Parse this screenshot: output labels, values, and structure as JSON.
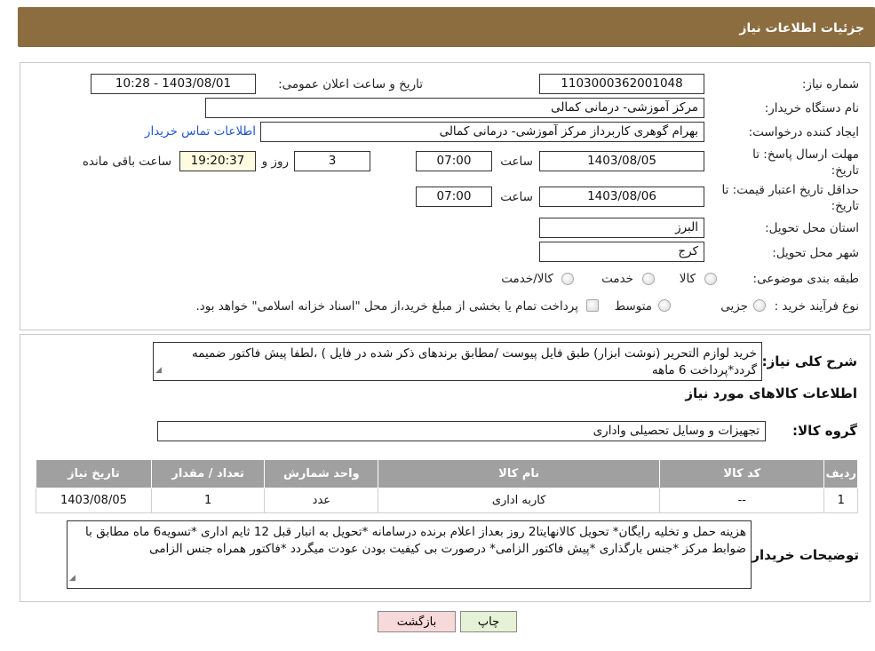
{
  "header": {
    "title": "جزئیات اطلاعات نیاز"
  },
  "form": {
    "need_number_label": "شماره نیاز:",
    "need_number": "1103000362001048",
    "announce_label": "تاریخ و ساعت اعلان عمومی:",
    "announce_value": "1403/08/01 - 10:28",
    "buyer_org_label": "نام دستگاه خریدار:",
    "buyer_org": "مرکز آموزشی- درمانی کمالی",
    "creator_label": "ایجاد کننده درخواست:",
    "creator": "بهرام گوهری کاربرداز مرکز آموزشی- درمانی کمالی",
    "contact_link": "اطلاعات تماس خریدار",
    "deadline_label_1": "مهلت ارسال پاسخ: تا",
    "deadline_label_2": "تاریخ:",
    "deadline_date": "1403/08/05",
    "time_label": "ساعت",
    "deadline_time": "07:00",
    "days_value": "3",
    "days_label": "روز و",
    "remaining_time": "19:20:37",
    "remaining_label": "ساعت باقی مانده",
    "validity_label_1": "حداقل تاریخ اعتبار قیمت: تا",
    "validity_label_2": "تاریخ:",
    "validity_date": "1403/08/06",
    "validity_time": "07:00",
    "province_label": "استان محل تحویل:",
    "province": "البرز",
    "city_label": "شهر محل تحویل:",
    "city": "کرج",
    "category_label": "طبقه بندی موضوعی:",
    "category_options": [
      "کالا",
      "خدمت",
      "کالا/خدمت"
    ],
    "purchase_type_label": "نوع فرآیند خرید :",
    "purchase_options": [
      "جزیی",
      "متوسط"
    ],
    "payment_note": "پرداخت تمام یا بخشی از مبلغ خرید،از محل \"اسناد خزانه اسلامی\" خواهد بود."
  },
  "details": {
    "description_label": "شرح کلی نیاز:",
    "description": "خرید لوازم التحریر (نوشت ابزار) طبق فایل پیوست /مطابق برندهای ذکر شده در فایل ) ،لطفا پیش فاکتور ضمیمه گردد*پرداخت 6 ماهه",
    "goods_info_title": "اطلاعات کالاهای مورد نیاز",
    "goods_group_label": "گروه کالا:",
    "goods_group": "تجهیزات و وسایل تحصیلی واداری",
    "table": {
      "headers": [
        "ردیف",
        "کد کالا",
        "نام کالا",
        "واحد شمارش",
        "تعداد / مقدار",
        "تاریخ نیاز"
      ],
      "rows": [
        [
          "1",
          "--",
          "کاربه اداری",
          "عدد",
          "1",
          "1403/08/05"
        ]
      ]
    },
    "buyer_notes_label": "توضیحات خریدار:",
    "buyer_notes": "هزینه حمل و تخلیه رایگان* تحویل کالانهایتا2 روز بعداز اعلام برنده درسامانه *تحویل به انبار قبل 12 ثایم اداری *تسویه6 ماه مطابق با ضوابط مرکز *جنس بارگذاری *پیش فاکتور الزامی* درصورت بی کیفیت بودن عودت میگردد *فاکتور همراه جنس الزامی"
  },
  "buttons": {
    "print": "چاپ",
    "back": "بازگشت"
  },
  "colors": {
    "header_bg": "#8b6d40",
    "table_header_bg": "#a0a0a0",
    "back_btn_bg": "#f7d9d9",
    "print_btn_bg": "#e6f2d6"
  }
}
